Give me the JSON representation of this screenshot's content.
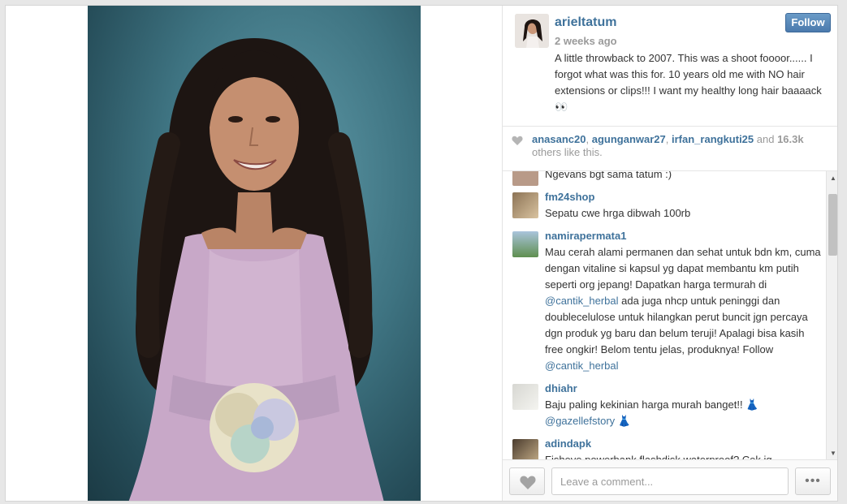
{
  "post": {
    "username": "arieltatum",
    "timestamp": "2 weeks ago",
    "follow_label": "Follow",
    "caption": "A little throwback to 2007. This was a shoot foooor...... I forgot what was this for. 10 years old me with NO hair extensions or clips!!! I want my healthy long hair baaaack 👀"
  },
  "likes": {
    "user1": "anasanc20",
    "sep1": ", ",
    "user2": "agunganwar27",
    "sep2": ", ",
    "user3": "irfan_rangkuti25",
    "and": " and ",
    "count": "16.3k",
    "suffix": " others like this."
  },
  "comments": {
    "partial_text": "Ngevans bgt sama tatum :)",
    "items": [
      {
        "username": "fm24shop",
        "text": "Sepatu cwe hrga dibwah 100rb"
      },
      {
        "username": "namirapermata1",
        "text_a": "Mau cerah alami permanen dan sehat untuk bdn km, cuma dengan vitaline si kapsul yg dapat membantu km putih seperti org jepang! Dapatkan harga termurah di ",
        "mention_a": "@cantik_herbal",
        "text_b": " ada juga nhcp untuk peninggi dan doublecelulose untuk hilangkan perut buncit jgn percaya dgn produk yg baru dan belum teruji! Apalagi bisa kasih free ongkir! Belom tentu jelas, produknya! Follow ",
        "mention_b": "@cantik_herbal"
      },
      {
        "username": "dhiahr",
        "text_a": "Baju paling kekinian harga murah banget!! 👗 ",
        "mention_a": "@gazellefstory",
        "text_b": " 👗"
      },
      {
        "username": "adindapk",
        "text": "Fisheye,powerbank,flashdisk,waterproof? Cek ig"
      }
    ]
  },
  "footer": {
    "comment_placeholder": "Leave a comment...",
    "more_label": "•••"
  },
  "colors": {
    "link": "#3f729b",
    "follow_button": "#4b7aad",
    "photo_background": "#3e7381"
  }
}
